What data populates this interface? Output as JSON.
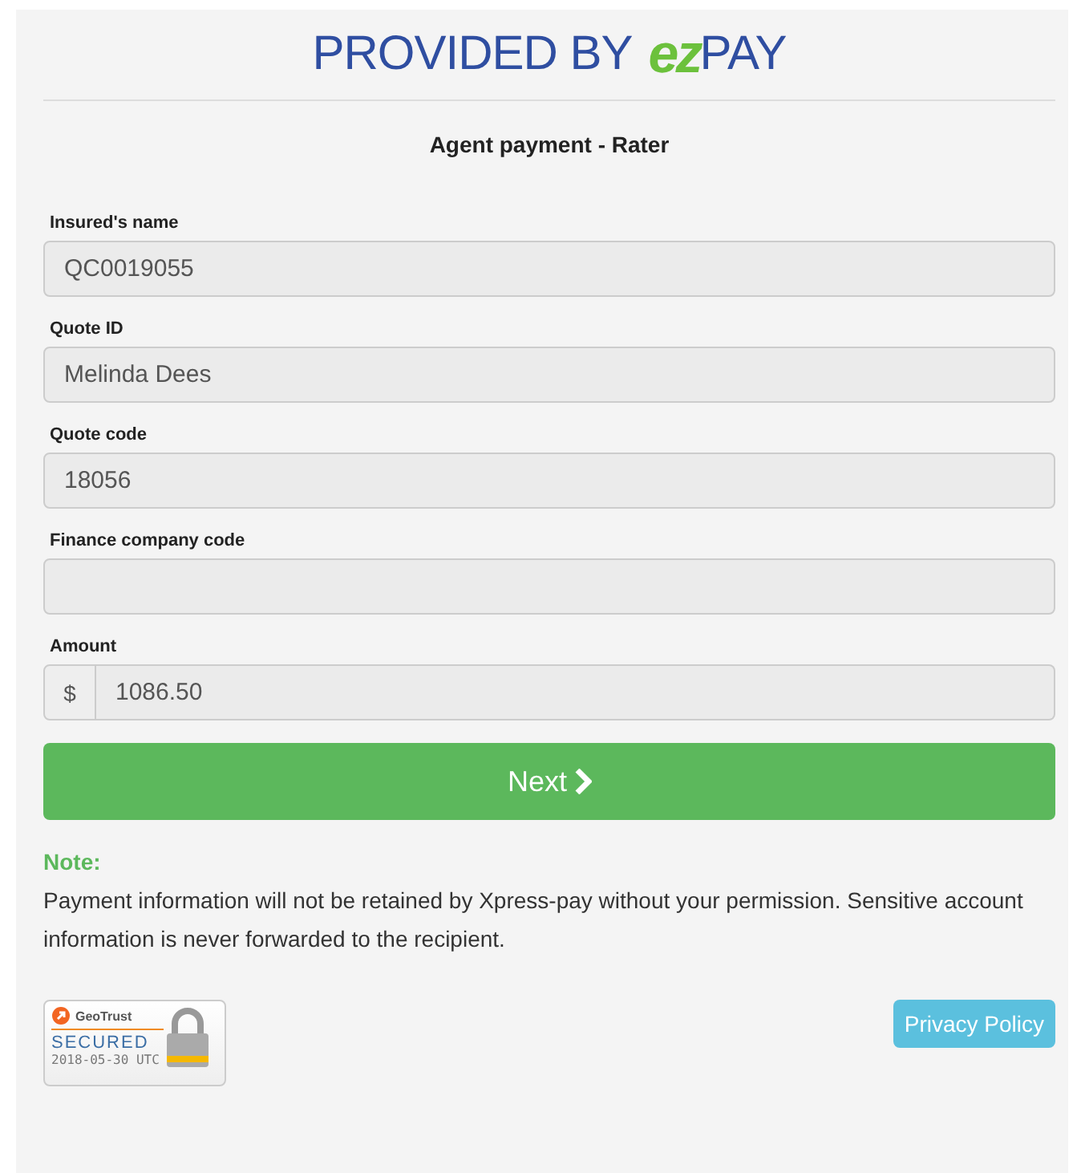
{
  "logo": {
    "prefix": "PROVIDED BY",
    "mark": "ez",
    "suffix": "PAY"
  },
  "title": "Agent payment - Rater",
  "fields": [
    {
      "label": "Insured's name",
      "value": "QC0019055"
    },
    {
      "label": "Quote ID",
      "value": "Melinda Dees"
    },
    {
      "label": "Quote code",
      "value": "18056"
    },
    {
      "label": "Finance company code"
    },
    {
      "label": "Amount",
      "addon": "$",
      "value": "1086.50"
    }
  ],
  "next_button": {
    "label": "Next"
  },
  "note": {
    "heading": "Note:",
    "text": "Payment information will not be retained by Xpress-pay without your permission. Sensitive account information is never forwarded to the recipient."
  },
  "seal": {
    "brand": "GeoTrust",
    "status": "SECURED",
    "date": "2018-05-30 UTC"
  },
  "privacy_button": {
    "label": "Privacy Policy"
  }
}
